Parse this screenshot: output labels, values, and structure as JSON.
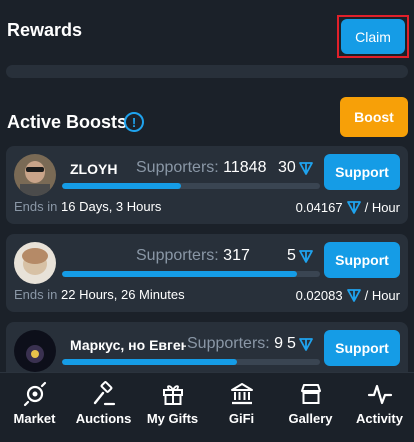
{
  "rewards": {
    "title": "Rewards",
    "claim_label": "Claim"
  },
  "boosts": {
    "title": "Active Boosts",
    "info_symbol": "!",
    "boost_label": "Boost",
    "supporters_label": "Supporters:",
    "ends_label": "Ends in",
    "rate_unit": "/ Hour",
    "support_label": "Support",
    "cards": [
      {
        "name": "ZLOYH",
        "supporters": "11848",
        "count": "30",
        "progress": 0.46,
        "ends": "16 Days, 3 Hours",
        "rate": "0.04167"
      },
      {
        "name": "",
        "supporters": "317",
        "count": "5",
        "progress": 0.91,
        "ends": "22 Hours, 26 Minutes",
        "rate": "0.02083"
      },
      {
        "name": "Маркус, но Евгени",
        "supporters": "9",
        "count": "5",
        "progress": 0.68,
        "ends": "",
        "rate": ""
      }
    ]
  },
  "nav": {
    "items": [
      {
        "label": "Market",
        "icon": "market-icon"
      },
      {
        "label": "Auctions",
        "icon": "gavel-icon"
      },
      {
        "label": "My Gifts",
        "icon": "gift-icon"
      },
      {
        "label": "GiFi",
        "icon": "bank-icon"
      },
      {
        "label": "Gallery",
        "icon": "store-icon"
      },
      {
        "label": "Activity",
        "icon": "activity-icon"
      }
    ]
  },
  "colors": {
    "accent": "#159ce6",
    "boost": "#f7a008",
    "claim_outline": "#e1202a",
    "background": "#1b2129",
    "card": "#28303a"
  }
}
